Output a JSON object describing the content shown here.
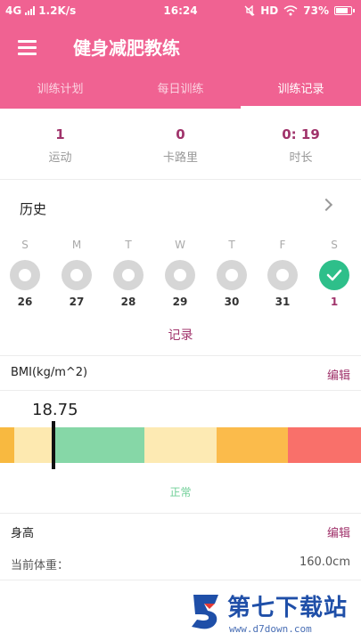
{
  "status_bar": {
    "network": "4G",
    "speed": "1.2K/s",
    "time": "16:24",
    "hd": "HD",
    "battery": "73%"
  },
  "toolbar": {
    "title": "健身减肥教练",
    "menu_icon": "hamburger-menu-icon"
  },
  "tabs": [
    {
      "label": "训练计划",
      "active": false
    },
    {
      "label": "每日训练",
      "active": false
    },
    {
      "label": "训练记录",
      "active": true
    }
  ],
  "stats": [
    {
      "value": "1",
      "label": "运动"
    },
    {
      "value": "0",
      "label": "卡路里"
    },
    {
      "value": "0: 19",
      "label": "时长"
    }
  ],
  "history": {
    "title": "历史",
    "days": [
      {
        "letter": "S",
        "date": "26",
        "done": false
      },
      {
        "letter": "M",
        "date": "27",
        "done": false
      },
      {
        "letter": "T",
        "date": "28",
        "done": false
      },
      {
        "letter": "W",
        "date": "29",
        "done": false
      },
      {
        "letter": "T",
        "date": "30",
        "done": false
      },
      {
        "letter": "F",
        "date": "31",
        "done": false
      },
      {
        "letter": "S",
        "date": "1",
        "done": true
      }
    ],
    "record_link": "记录"
  },
  "bmi": {
    "title": "BMI(kg/m^2)",
    "edit": "编辑",
    "value": "18.75",
    "status": "正常",
    "segment_colors": [
      "#f8b940",
      "#fde9b0",
      "#86d7a7",
      "#fdeab3",
      "#fbbb4b",
      "#f9706a"
    ]
  },
  "height": {
    "label": "身高",
    "edit": "编辑"
  },
  "weight": {
    "label": "当前体重：",
    "value": "160.0cm"
  },
  "watermark": {
    "title": "第七下载站",
    "url": "www.d7down.com"
  },
  "colors": {
    "header": "#f06292",
    "accent": "#a0336b",
    "done": "#2ebf8a"
  }
}
